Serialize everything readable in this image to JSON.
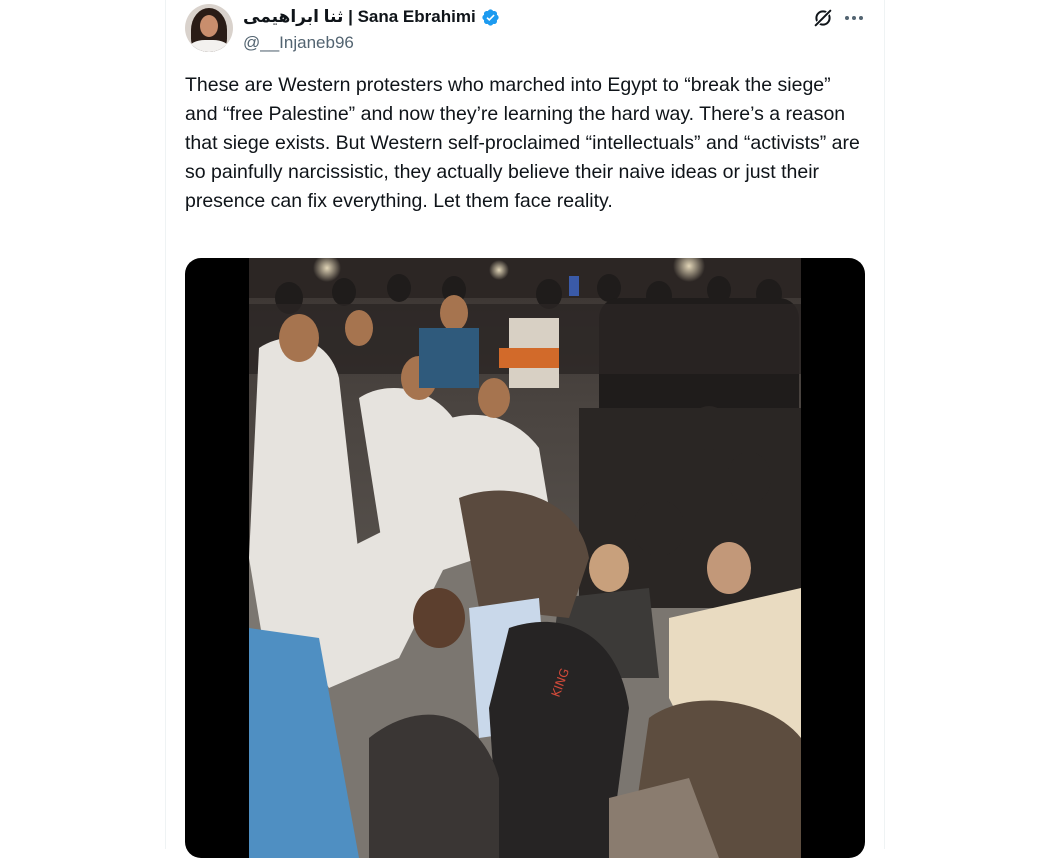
{
  "tweet": {
    "author": {
      "display_name": "ثنا ابراهیمی | Sana Ebrahimi",
      "handle": "@__Injaneb96",
      "verified": true,
      "verified_color": "#1d9bf0"
    },
    "text": "These are Western protesters who marched into Egypt to “break the siege” and “free Palestine” and now they’re learning the hard way. There’s a reason that siege exists. But Western self-proclaimed “intellectuals” and “activists” are so painfully narcissistic, they actually believe their naive ideas or just their presence can fix everything. Let them face reality.",
    "actions": {
      "grok_icon": "grok-icon",
      "more_icon": "more-icon"
    },
    "media": {
      "type": "video",
      "background": "#000000"
    }
  }
}
